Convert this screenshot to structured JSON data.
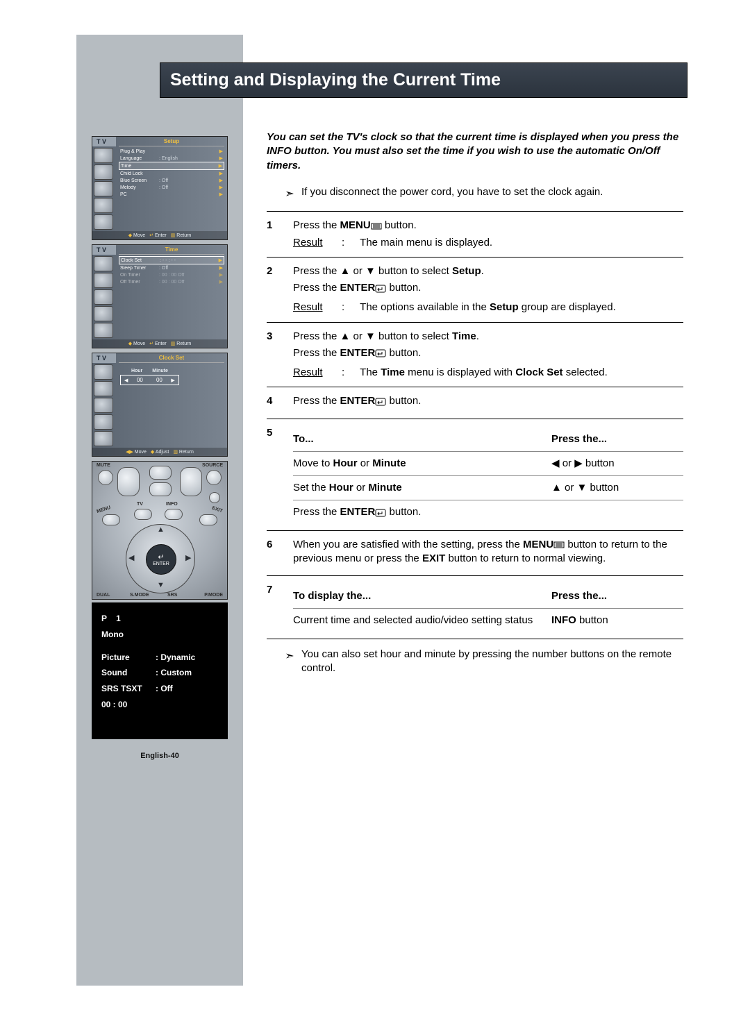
{
  "title": "Setting and Displaying the Current Time",
  "intro": "You can set the TV's clock so that the current time is displayed when you press the INFO button. You must also set the time if you wish to use the automatic On/Off timers.",
  "note_top": "If you disconnect the power cord, you have to set the clock again.",
  "steps": {
    "s1_a": "Press the ",
    "s1_b": " button.",
    "s1_result": "The main menu is displayed.",
    "s2_a": "Press the ▲ or ▼ button to select ",
    "s2_setup": "Setup",
    "s2_b": ".",
    "s2_c": "Press the ",
    "s2_d": " button.",
    "s2_result_a": "The options available in the ",
    "s2_result_b": " group are displayed.",
    "s3_a": "Press the ▲ or ▼ button to select ",
    "s3_time": "Time",
    "s3_b": ".",
    "s3_c": "Press the ",
    "s3_d": " button.",
    "s3_result_a": "The ",
    "s3_result_b": " menu is displayed with ",
    "s3_clockset": "Clock Set",
    "s3_result_c": " selected.",
    "s4_a": "Press the ",
    "s4_b": " button.",
    "s5_to": "To...",
    "s5_press": "Press the...",
    "s5_r1_a": "Move to ",
    "s5_hour": "Hour",
    "s5_or": " or ",
    "s5_minute": "Minute",
    "s5_r1_b": "◀ or ▶ button",
    "s5_r2_a": "Set the ",
    "s5_r2_b": "▲ or ▼ button",
    "s5_r3_a": "Press the ",
    "s5_r3_b": " button.",
    "s6_a": "When you are satisfied with the setting, press the ",
    "s6_b": " button to return to the previous menu or press the ",
    "s6_exit": "EXIT",
    "s6_c": " button to return to normal viewing.",
    "s7_to": "To display the...",
    "s7_press": "Press the...",
    "s7_r1_a": "Current time and selected audio/video setting status",
    "s7_info": "INFO",
    "s7_r1_b": " button"
  },
  "note_bottom": "You can also set hour and minute by pressing the number buttons on the remote control.",
  "labels": {
    "menu": "MENU",
    "enter": "ENTER",
    "result": "Result"
  },
  "osd_setup": {
    "tv": "T V",
    "title": "Setup",
    "items": [
      {
        "lbl": "Plug & Play",
        "val": ""
      },
      {
        "lbl": "Language",
        "val": ": English"
      },
      {
        "lbl": "Time",
        "val": ""
      },
      {
        "lbl": "Child Lock",
        "val": ""
      },
      {
        "lbl": "Blue Screen",
        "val": ": Off"
      },
      {
        "lbl": "Melody",
        "val": ": Off"
      },
      {
        "lbl": "PC",
        "val": ""
      }
    ],
    "footer": {
      "move": "Move",
      "enter": "Enter",
      "return": "Return"
    }
  },
  "osd_time": {
    "tv": "T V",
    "title": "Time",
    "items": [
      {
        "lbl": "Clock Set",
        "val": ":      - - : - -"
      },
      {
        "lbl": "Sleep Timer",
        "val": ":          Off"
      },
      {
        "lbl": "On Timer",
        "val": ":   00 : 00     Off"
      },
      {
        "lbl": "Off Timer",
        "val": ":   00 : 00     Off"
      }
    ],
    "footer": {
      "move": "Move",
      "enter": "Enter",
      "return": "Return"
    }
  },
  "osd_clock": {
    "tv": "T V",
    "title": "Clock Set",
    "hour_label": "Hour",
    "minute_label": "Minute",
    "hour": "00",
    "minute": "00",
    "footer": {
      "move": "Move",
      "adjust": "Adjust",
      "return": "Return"
    }
  },
  "remote": {
    "mute": "MUTE",
    "source": "SOURCE",
    "menu": "MENU",
    "tv": "TV",
    "info": "INFO",
    "exit": "EXIT",
    "enter": "ENTER",
    "dual": "DUAL",
    "smode": "S.MODE",
    "srs": "SRS",
    "pmode": "P.MODE"
  },
  "info_panel": {
    "p": "P    1",
    "mono": "Mono",
    "rows": [
      {
        "k": "Picture",
        "v": ": Dynamic"
      },
      {
        "k": "Sound",
        "v": ": Custom"
      },
      {
        "k": "SRS TSXT",
        "v": ": Off"
      }
    ],
    "time": "00 : 00"
  },
  "page_num": "English-40"
}
